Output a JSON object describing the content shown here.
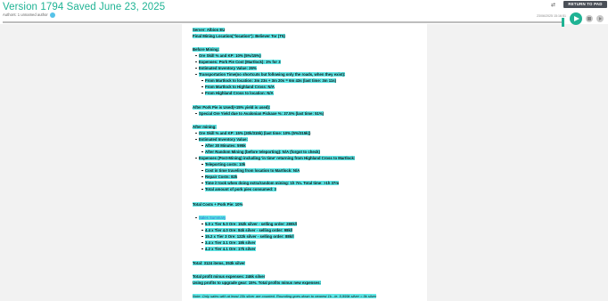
{
  "header": {
    "title": "Version 1794 Saved June 23, 2025",
    "authors": "Authors: 1 unnamed author",
    "return_label": "RETURN TO PAD",
    "timestamp": "23/06/2025 15:16:51"
  },
  "doc": {
    "lines": [
      "Server: Albion EU",
      "Final Mining Location(\"location\"): Believer Tor (T5)",
      "Before Mining:",
      "Ore Skill % and KP: 10% (5%/15%)",
      "Expenses: Pork Pie Cost (Martlock): 1% for 3",
      "Estimated Inventory Value: 26%",
      "Transportation Time(no shortcuts but following only the roads, when they exist):",
      "From Martlock to location: 3m 23s + 3m 20s = 6m 43s (last time: 3m 11s)",
      "From Martlock to Highland Cross: N/A",
      "From Highland Cross to location: N/A",
      "After Pork Pie is Used(+15% yield is used):",
      "Special Ore Yield due to Avalonian Pickaxe %: 37.5% (last time: 51%)",
      "After mining:",
      "Ore Skill % and KP: 15% (30k/315k) (last time: 10% (5%/315k))",
      "Estimated Inventory Value:",
      "After 30 Minutes: 595k",
      "After Random Mining (before teleporting): N/A (forgot to check)",
      "Expenses (Post-Mining) including 'in time' returning from Highland Cross to Martlock:",
      "Teleporting costs: 10k",
      "Cost in time traveling from location to Martlock: N/A",
      "Repair Costs: 82k",
      "Time it took when doing extra/random mining: 1h 7m. Total time: >1h 37m",
      "Total amount of pork pies consumed: 3",
      "Total Costs + Pork Pie: 10%",
      "Sales Summary",
      "5.0 x Tier 5.0 Ore: 152k silver - selling order: 280k/l",
      "4.4 x Tier 4.0 Ore: 84k silver - selling order: 98k/l",
      "15.2 x Tier 3 Ore: 122k silver - selling order: 88k/l",
      "3.4 x Tier 3.1 Ore: 18k silver",
      "4.2 x Tier 4.1 Ore: 17k silver",
      "Total: 3124 items, 353k silver",
      "Total profit minus expenses: 246k silver",
      "Using profits to upgrade gear: 15%. Total profits minus new expenses:",
      "Note: Only sales with at least 10k silver are counted. Rounding goes down to nearest 1k...ie. 9,999k silver = 9k silver"
    ]
  }
}
